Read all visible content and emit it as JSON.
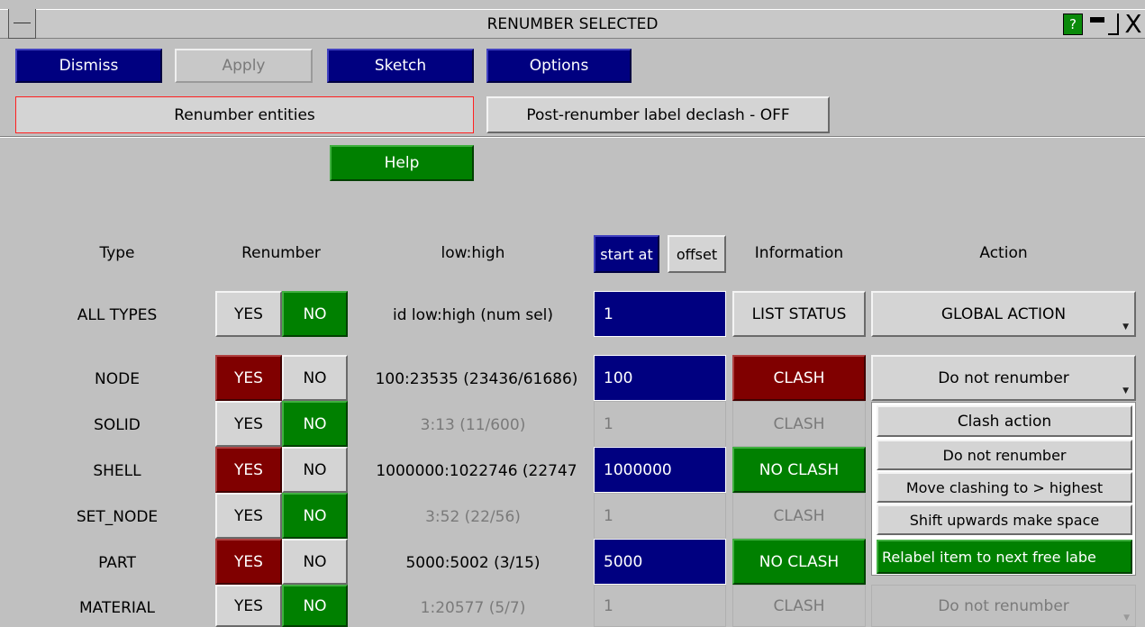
{
  "window": {
    "title": "RENUMBER SELECTED",
    "help_glyph": "?",
    "close_glyph": "X"
  },
  "toolbar": {
    "dismiss": "Dismiss",
    "apply": "Apply",
    "sketch": "Sketch",
    "options": "Options"
  },
  "mode": {
    "renumber_entities": "Renumber entities",
    "declash": "Post-renumber label declash - OFF"
  },
  "help_label": "Help",
  "headers": {
    "type": "Type",
    "renumber": "Renumber",
    "lowhigh": "low:high",
    "start_at": "start at",
    "offset": "offset",
    "information": "Information",
    "action": "Action"
  },
  "all_types": {
    "type": "ALL TYPES",
    "yes": "YES",
    "no": "NO",
    "range": "id low:high (num sel)",
    "start": "1",
    "info": "LIST STATUS",
    "action": "GLOBAL ACTION"
  },
  "rows": [
    {
      "type": "NODE",
      "yes": "YES",
      "no": "NO",
      "renumber": "YES",
      "range": "100:23535 (23436/61686)",
      "start": "100",
      "info": "CLASH",
      "info_status": "clash",
      "action": "Do not renumber"
    },
    {
      "type": "SOLID",
      "yes": "YES",
      "no": "NO",
      "renumber": "NO",
      "range": "3:13 (11/600)",
      "start": "1",
      "info": "CLASH",
      "info_status": "inactive"
    },
    {
      "type": "SHELL",
      "yes": "YES",
      "no": "NO",
      "renumber": "YES",
      "range": "1000000:1022746 (22747",
      "start": "1000000",
      "info": "NO CLASH",
      "info_status": "ok"
    },
    {
      "type": "SET_NODE",
      "yes": "YES",
      "no": "NO",
      "renumber": "NO",
      "range": "3:52 (22/56)",
      "start": "1",
      "info": "CLASH",
      "info_status": "inactive"
    },
    {
      "type": "PART",
      "yes": "YES",
      "no": "NO",
      "renumber": "YES",
      "range": "5000:5002 (3/15)",
      "start": "5000",
      "info": "NO CLASH",
      "info_status": "ok"
    },
    {
      "type": "MATERIAL",
      "yes": "YES",
      "no": "NO",
      "renumber": "NO",
      "range": "1:20577 (5/7)",
      "start": "1",
      "info": "CLASH",
      "info_status": "inactive",
      "action": "Do not renumber"
    }
  ],
  "clash_menu": {
    "title": "Clash action",
    "items": [
      "Do not renumber",
      "Move clashing to > highest",
      "Shift upwards make space",
      "Relabel item to next free labe"
    ],
    "selected_index": 3
  },
  "colors": {
    "background": "#c0c0c0",
    "blue": "#000080",
    "green": "#008000",
    "red": "#800000"
  }
}
